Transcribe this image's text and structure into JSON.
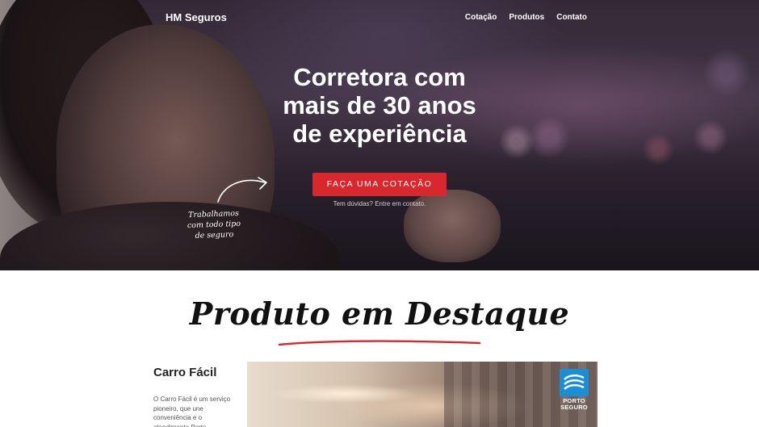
{
  "header": {
    "brand": "HM Seguros",
    "nav": [
      "Cotação",
      "Produtos",
      "Contato"
    ]
  },
  "hero": {
    "headline_lines": [
      "Corretora com",
      "mais de 30 anos",
      "de experiência"
    ],
    "cta_label": "FAÇA UMA COTAÇÃO",
    "sub_link": "Tem dúvidas? Entre em contato.",
    "handnote_lines": [
      "Trabalhamos",
      "com todo tipo",
      "de seguro"
    ]
  },
  "featured": {
    "title": "Produto em Destaque",
    "product_name": "Carro Fácil",
    "product_desc": "O Carro Fácil é um serviço pioneiro, que une conveniência e o atendimento Porto",
    "logo_lines": [
      "PORTO",
      "SEGURO"
    ]
  },
  "colors": {
    "accent": "#d9272e",
    "logo_blue": "#1a8fd6"
  }
}
